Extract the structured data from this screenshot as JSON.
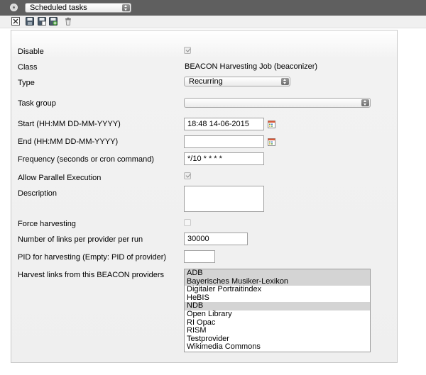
{
  "header": {
    "dropdown_value": "Scheduled tasks"
  },
  "toolbar": {
    "icons": [
      "close-icon",
      "save-icon",
      "save-copy-icon",
      "save-new-icon",
      "trash-icon"
    ]
  },
  "form": {
    "disable": {
      "label": "Disable",
      "checked": true
    },
    "class": {
      "label": "Class",
      "value": "BEACON Harvesting Job (beaconizer)"
    },
    "type": {
      "label": "Type",
      "value": "Recurring"
    },
    "task_group": {
      "label": "Task group",
      "value": ""
    },
    "start": {
      "label": "Start (HH:MM DD-MM-YYYY)",
      "value": "18:48 14-06-2015"
    },
    "end": {
      "label": "End (HH:MM DD-MM-YYYY)",
      "value": ""
    },
    "frequency": {
      "label": "Frequency (seconds or cron command)",
      "value": "*/10 * * * *"
    },
    "parallel": {
      "label": "Allow Parallel Execution",
      "checked": true
    },
    "description": {
      "label": "Description",
      "value": ""
    },
    "force": {
      "label": "Force harvesting",
      "checked": false
    },
    "links_per_run": {
      "label": "Number of links per provider per run",
      "value": "30000"
    },
    "pid": {
      "label": "PID for harvesting (Empty: PID of provider)",
      "value": ""
    },
    "providers": {
      "label": "Harvest links from this BEACON providers",
      "options": [
        {
          "label": "ADB",
          "selected": true
        },
        {
          "label": "Bayerisches Musiker-Lexikon",
          "selected": true
        },
        {
          "label": "Digitaler Portraitindex",
          "selected": false
        },
        {
          "label": "HeBIS",
          "selected": false
        },
        {
          "label": "NDB",
          "selected": true
        },
        {
          "label": "Open Library",
          "selected": false
        },
        {
          "label": "RI Opac",
          "selected": false
        },
        {
          "label": "RISM",
          "selected": false
        },
        {
          "label": "Testprovider",
          "selected": false
        },
        {
          "label": "Wikimedia Commons",
          "selected": false
        }
      ]
    }
  }
}
